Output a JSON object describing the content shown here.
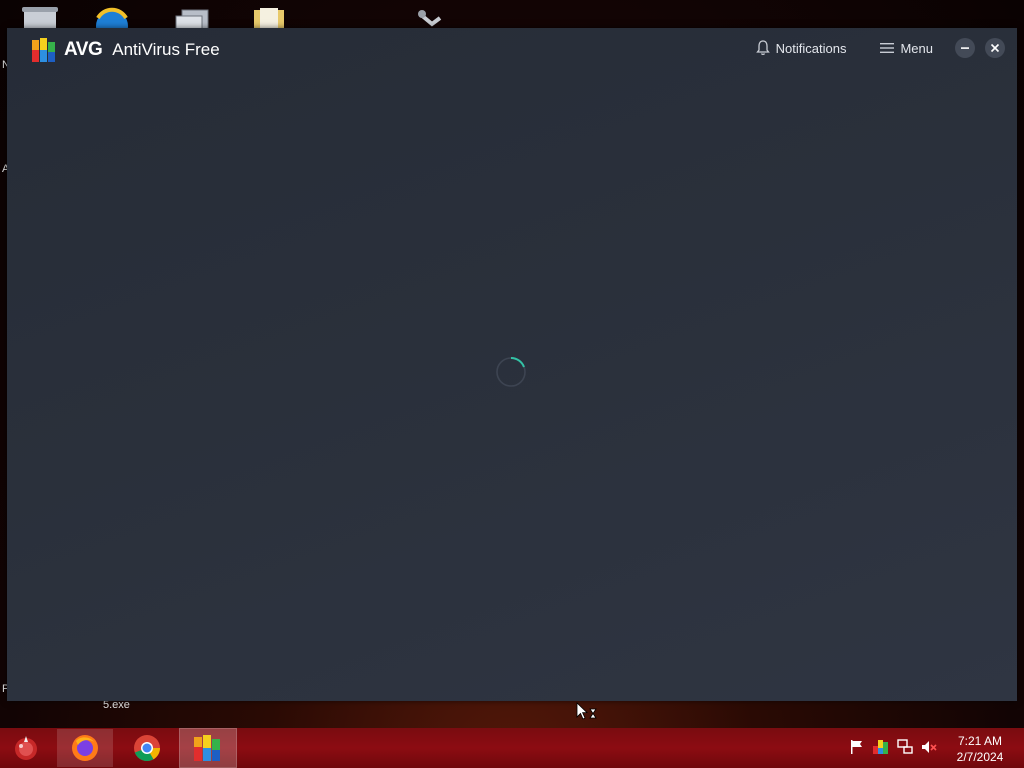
{
  "desktop": {
    "edge_letters": [
      "N",
      "A",
      "P"
    ],
    "file_label": "5.exe"
  },
  "window": {
    "brand": "AVG",
    "product": "AntiVirus Free",
    "notifications_label": "Notifications",
    "menu_label": "Menu",
    "content_state": "loading"
  },
  "taskbar": {
    "apps": [
      "firefox-icon",
      "chrome-icon",
      "avg-icon"
    ],
    "active_app": "avg-icon",
    "tray_icons": [
      "action-center-flag-icon",
      "avg-tray-icon",
      "network-icon",
      "volume-muted-icon"
    ],
    "time": "7:21 AM",
    "date": "2/7/2024"
  },
  "colors": {
    "window_bg": "#2a303b",
    "spinner_accent": "#33c2a6",
    "taskbar": "#8c0c12"
  }
}
